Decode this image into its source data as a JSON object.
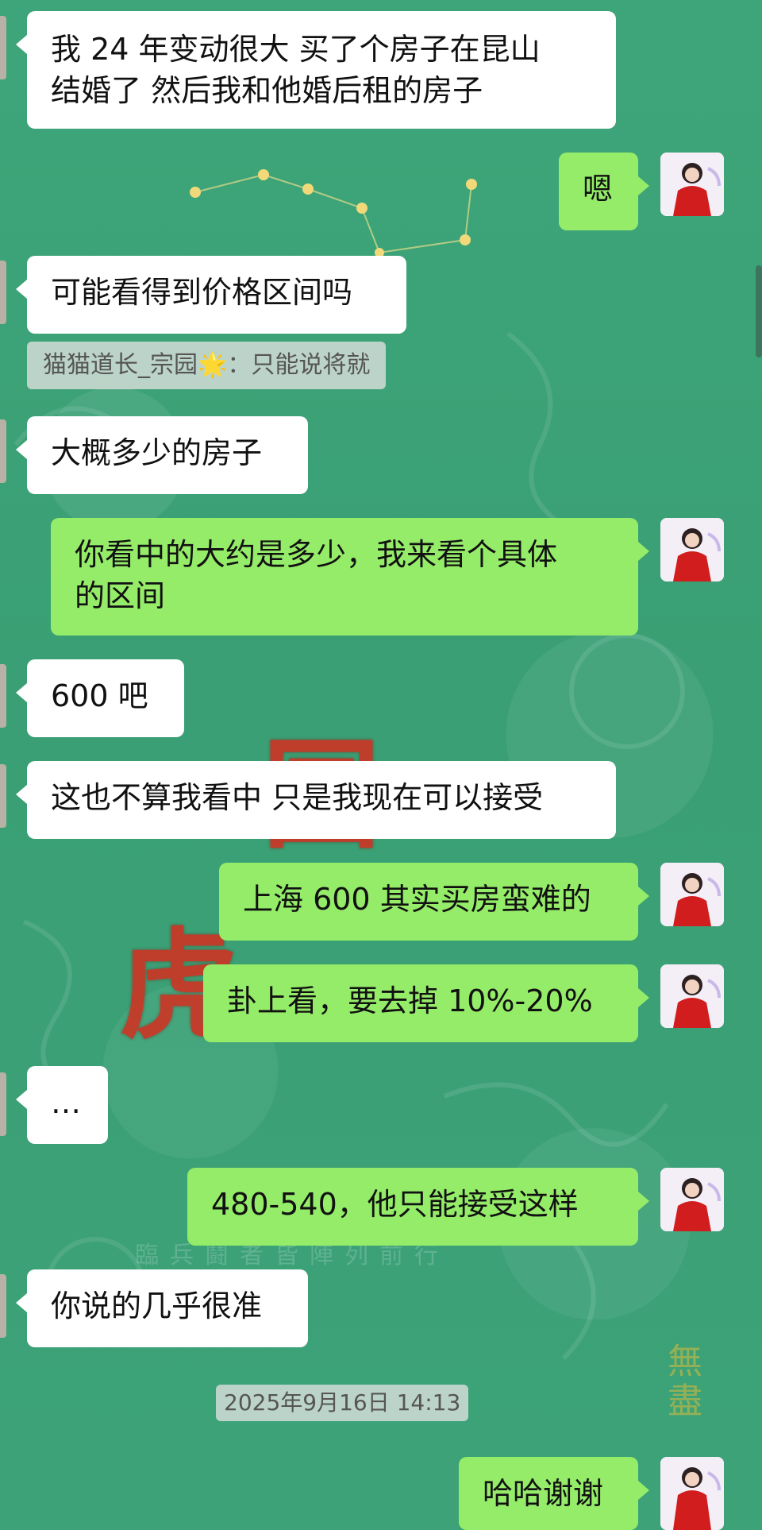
{
  "messages": [
    {
      "side": "left",
      "text": "我 24 年变动很大 买了个房子在昆山\n结婚了 然后我和他婚后租的房子"
    },
    {
      "side": "right",
      "text": "嗯"
    },
    {
      "side": "left",
      "text": "可能看得到价格区间吗"
    },
    {
      "side": "left",
      "text": "大概多少的房子"
    },
    {
      "side": "right",
      "text": "你看中的大约是多少，我来看个具体\n的区间"
    },
    {
      "side": "left",
      "text": "600 吧"
    },
    {
      "side": "left",
      "text": "这也不算我看中 只是我现在可以接受"
    },
    {
      "side": "right",
      "text": "上海 600 其实买房蛮难的"
    },
    {
      "side": "right",
      "text": "卦上看，要去掉 10%-20%"
    },
    {
      "side": "left",
      "text": "…"
    },
    {
      "side": "right",
      "text": "480-540，他只能接受这样"
    },
    {
      "side": "left",
      "text": "你说的几乎很准"
    },
    {
      "side": "right",
      "text": "哈哈谢谢"
    }
  ],
  "quote": {
    "text": "猫猫道长_宗园🌟：只能说将就"
  },
  "timestamp": "2025年9月16日 14:13",
  "background": {
    "watermark_line": "臨兵鬪者皆陣列前行",
    "corner_chars": "無盡",
    "red_chars": [
      "国",
      "虎"
    ]
  },
  "colors": {
    "bg": "#3ea57a",
    "bubble_left": "#ffffff",
    "bubble_right": "#95ec69"
  }
}
